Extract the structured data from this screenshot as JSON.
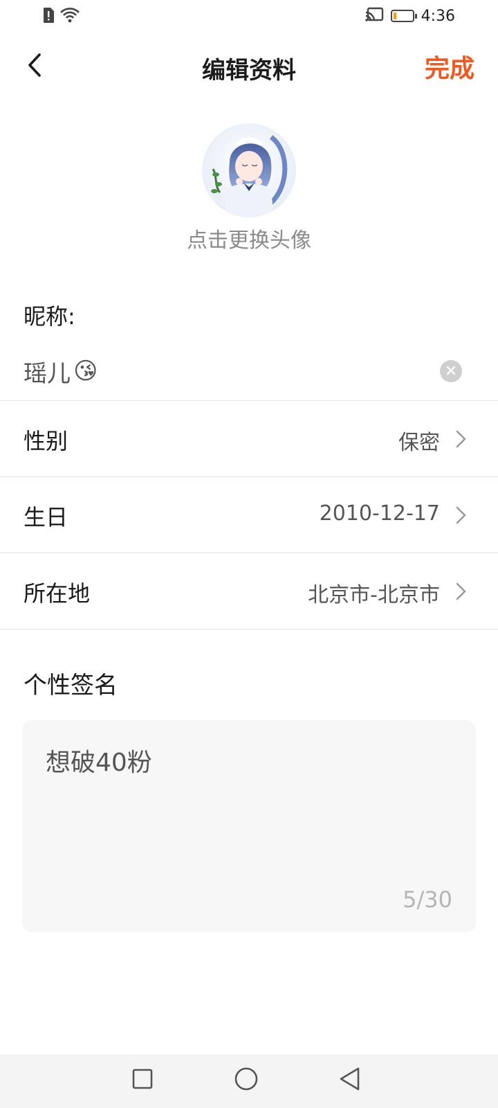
{
  "status_bar": {
    "time": "4:36",
    "left_icons": [
      "alert-sim-icon",
      "wifi-icon"
    ],
    "right_icons": [
      "cast-icon",
      "battery-icon"
    ],
    "battery_level": 0.15,
    "battery_color": "#ff9a00"
  },
  "header": {
    "title": "编辑资料",
    "done_label": "完成",
    "accent_color": "#ee5a1f"
  },
  "avatar": {
    "hint": "点击更换头像"
  },
  "nickname": {
    "label": "昵称:",
    "value": "瑶儿",
    "emoji": "😘"
  },
  "fields": [
    {
      "label": "性别",
      "value": "保密"
    },
    {
      "label": "生日",
      "value": "2010-12-17"
    },
    {
      "label": "所在地",
      "value": "北京市-北京市"
    }
  ],
  "signature": {
    "label": "个性签名",
    "value": "想破40粉",
    "counter": "5/30"
  },
  "nav_bar": {
    "buttons": [
      "recent-apps-icon",
      "home-icon",
      "back-triangle-icon"
    ]
  }
}
